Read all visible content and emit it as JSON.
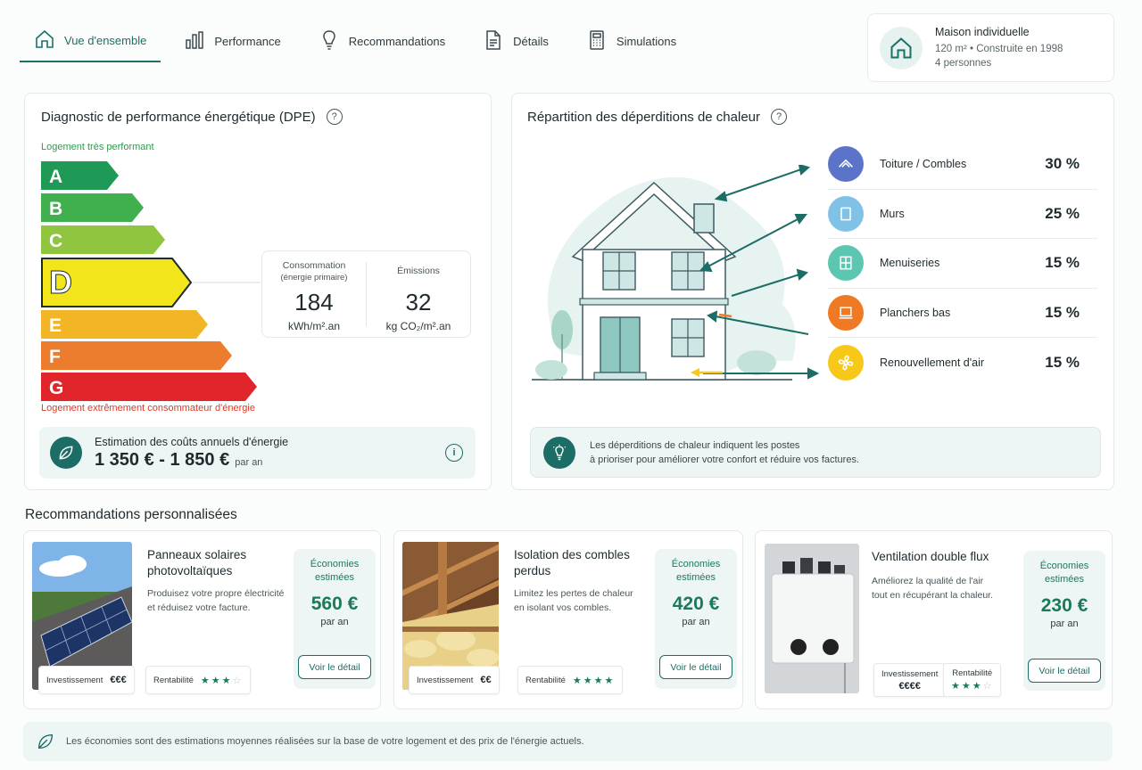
{
  "nav": {
    "tabs": [
      {
        "label": "Vue d'ensemble",
        "icon": "home-icon",
        "active": true
      },
      {
        "label": "Performance",
        "icon": "bar-chart-icon"
      },
      {
        "label": "Recommandations",
        "icon": "lightbulb-icon"
      },
      {
        "label": "Détails",
        "icon": "document-icon"
      },
      {
        "label": "Simulations",
        "icon": "calculator-icon"
      }
    ]
  },
  "house": {
    "title": "Maison individuelle",
    "line1": "120 m² • Construite en 1998",
    "line2": "4 personnes"
  },
  "dpe": {
    "title": "Diagnostic de performance énergétique (DPE)",
    "top_label": "Logement très performant",
    "bottom_label": "Logement extrêmement consommateur d'énergie",
    "classes": [
      "A",
      "B",
      "C",
      "D",
      "E",
      "F",
      "G"
    ],
    "current_class": "D",
    "class_colors": {
      "A": "#1e9a56",
      "B": "#3fb04d",
      "C": "#8fc53f",
      "D": "#f2e51c",
      "E": "#f2b526",
      "F": "#ec7c2e",
      "G": "#e0262a"
    },
    "consumption": {
      "label1": "Consommation",
      "label2": "(énergie primaire)",
      "value": "184",
      "unit": "kWh/m².an"
    },
    "emissions": {
      "label": "Émissions",
      "value": "32",
      "unit": "kg CO₂/m².an"
    },
    "cost": {
      "label": "Estimation des coûts annuels d'énergie",
      "value": "1 350 € - 1 850 €",
      "period": "par an"
    }
  },
  "losses": {
    "title": "Répartition des déperditions de chaleur",
    "items": [
      {
        "label": "Toiture / Combles",
        "value": "30 %",
        "color": "#5b74c9",
        "icon": "roof-icon"
      },
      {
        "label": "Murs",
        "value": "25 %",
        "color": "#7fc2e6",
        "icon": "wall-icon"
      },
      {
        "label": "Menuiseries",
        "value": "15 %",
        "color": "#5cc6b0",
        "icon": "window-icon"
      },
      {
        "label": "Planchers bas",
        "value": "15 %",
        "color": "#f07a24",
        "icon": "floor-icon"
      },
      {
        "label": "Renouvellement d'air",
        "value": "15 %",
        "color": "#f8c818",
        "icon": "fan-icon"
      }
    ],
    "tip_line1": "Les déperditions de chaleur indiquent les postes",
    "tip_line2": "à prioriser pour améliorer votre confort et réduire vos factures."
  },
  "recommendations": {
    "title": "Recommandations personnalisées",
    "save_label_1": "Économies",
    "save_label_2": "estimées",
    "per_year": "par an",
    "button": "Voir le détail",
    "invest_label": "Investissement",
    "profit_label": "Rentabilité",
    "cards": [
      {
        "title1": "Panneaux solaires",
        "title2": "photovoltaïques",
        "desc1": "Produisez votre propre électricité",
        "desc2": "et réduisez votre facture.",
        "savings": "560 €",
        "investment": "€€€",
        "stars": 3
      },
      {
        "title1": "Isolation des combles",
        "title2": "perdus",
        "desc1": "Limitez les pertes de chaleur",
        "desc2": "en isolant vos combles.",
        "savings": "420 €",
        "investment": "€€",
        "stars": 4
      },
      {
        "title1": "Ventilation double flux",
        "title2": "",
        "desc1": "Améliorez la qualité de l'air",
        "desc2": "tout en récupérant la chaleur.",
        "savings": "230 €",
        "investment": "€€€€",
        "stars": 3
      }
    ]
  },
  "footer": {
    "text": "Les économies sont des estimations moyennes réalisées sur la base de votre logement et des prix de l'énergie actuels."
  }
}
